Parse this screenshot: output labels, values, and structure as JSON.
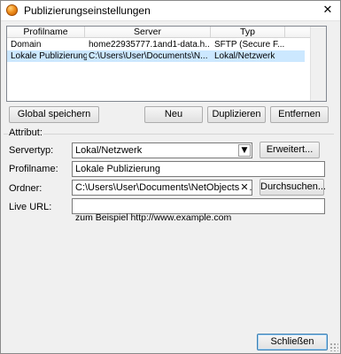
{
  "window": {
    "title": "Publizierungseinstellungen",
    "close_glyph": "✕"
  },
  "list": {
    "columns": [
      "Profilname",
      "Server",
      "Typ"
    ],
    "rows": [
      {
        "profilname": "Domain",
        "server": "home22935777.1and1-data.h...",
        "typ": "SFTP (Secure F...",
        "selected": false
      },
      {
        "profilname": "Lokale Publizierung",
        "server": "C:\\Users\\User\\Documents\\N...",
        "typ": "Lokal/Netzwerk",
        "selected": true
      }
    ]
  },
  "buttons": {
    "global_save": "Global speichern",
    "new": "Neu",
    "duplicate": "Duplizieren",
    "remove": "Entfernen",
    "advanced": "Erweitert...",
    "browse": "Durchsuchen...",
    "close": "Schließen"
  },
  "attribute": {
    "group_label": "Attribut:",
    "server_type_label": "Servertyp:",
    "server_type_value": "Lokal/Netzwerk",
    "profile_name_label": "Profilname:",
    "profile_name_value": "Lokale Publizierung",
    "folder_label": "Ordner:",
    "folder_value": "C:\\Users\\User\\Documents\\NetObjects Fusion",
    "live_url_label": "Live URL:",
    "live_url_value": "",
    "example_hint": "zum Beispiel http://www.example.com"
  },
  "icons": {
    "app": "netobjects-orange-ball-icon",
    "dropdown": "chevron-down-icon",
    "clear": "clear-x-icon"
  },
  "colors": {
    "selection": "#cce8ff",
    "default_button_border": "#3c7fb1"
  }
}
